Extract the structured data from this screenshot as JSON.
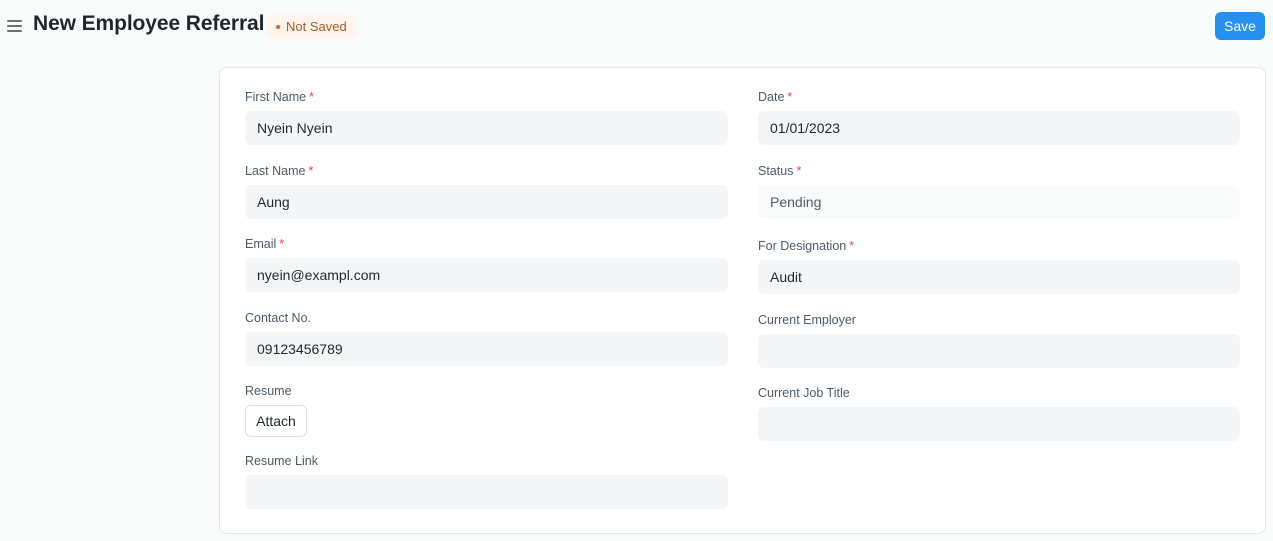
{
  "header": {
    "title": "New Employee Referral",
    "status": "Not Saved",
    "save_label": "Save"
  },
  "form": {
    "first_name": {
      "label": "First Name",
      "value": "Nyein Nyein",
      "required": "*"
    },
    "last_name": {
      "label": "Last Name",
      "value": "Aung",
      "required": "*"
    },
    "email": {
      "label": "Email",
      "value": "nyein@exampl.com",
      "required": "*"
    },
    "contact_no": {
      "label": "Contact No.",
      "value": "09123456789"
    },
    "resume": {
      "label": "Resume",
      "button_label": "Attach"
    },
    "resume_link": {
      "label": "Resume Link",
      "value": ""
    },
    "date": {
      "label": "Date",
      "value": "01/01/2023",
      "required": "*"
    },
    "status": {
      "label": "Status",
      "value": "Pending",
      "required": "*"
    },
    "for_designation": {
      "label": "For Designation",
      "value": "Audit",
      "required": "*"
    },
    "current_employer": {
      "label": "Current Employer",
      "value": ""
    },
    "current_job_title": {
      "label": "Current Job Title",
      "value": ""
    }
  },
  "colors": {
    "primary": "#2490ef",
    "badge_bg": "#fff4ec",
    "badge_text": "#a15b26",
    "required": "#e24c4c"
  }
}
